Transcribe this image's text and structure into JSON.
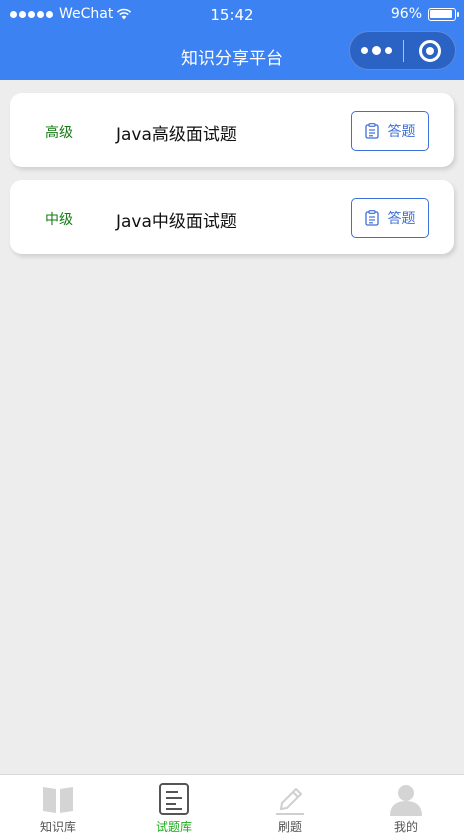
{
  "status_bar": {
    "carrier": "WeChat",
    "time": "15:42",
    "battery_percent": "96%"
  },
  "nav": {
    "title": "知识分享平台"
  },
  "questions": [
    {
      "level": "高级",
      "title": "Java高级面试题",
      "action_label": "答题"
    },
    {
      "level": "中级",
      "title": "Java中级面试题",
      "action_label": "答题"
    }
  ],
  "tabbar": {
    "items": [
      {
        "label": "知识库",
        "icon": "book-icon",
        "active": false
      },
      {
        "label": "试题库",
        "icon": "document-icon",
        "active": true
      },
      {
        "label": "刷题",
        "icon": "pencil-icon",
        "active": false
      },
      {
        "label": "我的",
        "icon": "person-icon",
        "active": false
      }
    ]
  },
  "colors": {
    "nav_bg": "#3d82f2",
    "accent_green": "#1aad19",
    "level_green": "#157a15",
    "button_blue": "#3d6fd8"
  }
}
